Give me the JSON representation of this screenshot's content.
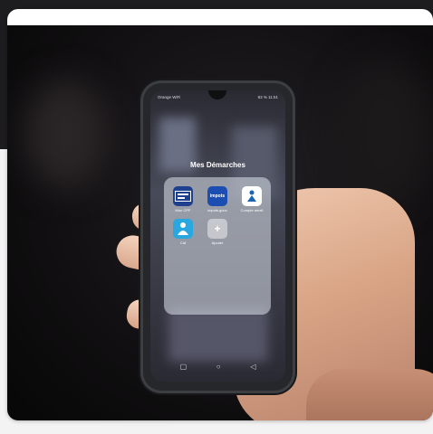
{
  "phone": {
    "status_left": "Orange WiFi",
    "status_right": "83 % 11:51",
    "folder_title": "Mes Démarches",
    "apps": [
      {
        "label": "Mon CPF",
        "icon_name": "mon-cpf-icon"
      },
      {
        "label": "impots.gouv",
        "icon_name": "impots-gouv-icon",
        "icon_text": "impots"
      },
      {
        "label": "Compte ameli",
        "icon_name": "ameli-icon"
      },
      {
        "label": "Caf",
        "icon_name": "caf-icon"
      },
      {
        "label": "Ajouter",
        "icon_name": "add-icon",
        "icon_text": "+"
      }
    ],
    "nav": {
      "recents": "▢",
      "home": "○",
      "back": "◁"
    }
  },
  "colors": {
    "cpf": "#1f3f8f",
    "impots": "#1c4db3",
    "ameli": "#ffffff",
    "caf": "#2aa7de"
  }
}
